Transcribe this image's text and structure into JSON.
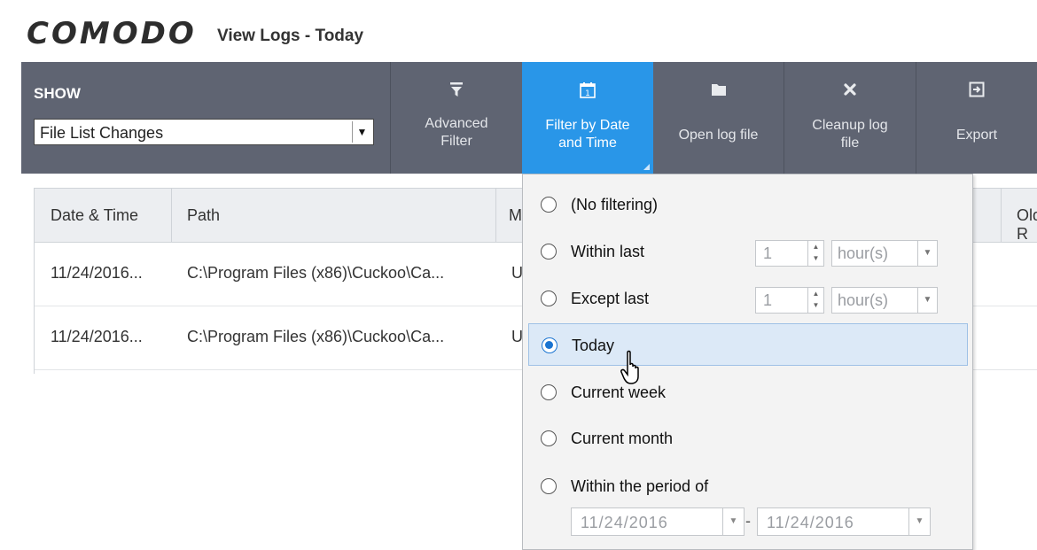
{
  "window": {
    "brand": "COMODO",
    "title": "View Logs - Today"
  },
  "toolbar": {
    "show_label": "SHOW",
    "show_value": "File List Changes",
    "buttons": [
      {
        "label_1": "Advanced",
        "label_2": "Filter",
        "icon": "funnel-icon"
      },
      {
        "label_1": "Filter by Date",
        "label_2": "and Time",
        "icon": "calendar-icon"
      },
      {
        "label_1": "Open log file",
        "label_2": "",
        "icon": "folder-icon"
      },
      {
        "label_1": "Cleanup log",
        "label_2": "file",
        "icon": "close-x-icon"
      },
      {
        "label_1": "Export",
        "label_2": "",
        "icon": "export-icon"
      }
    ],
    "calendar_day": "1"
  },
  "table": {
    "columns": [
      "Date & Time",
      "Path",
      "M",
      "Old R"
    ],
    "rows": [
      {
        "date": "11/24/2016...",
        "path": "C:\\Program Files (x86)\\Cuckoo\\Ca...",
        "m": "U"
      },
      {
        "date": "11/24/2016...",
        "path": "C:\\Program Files (x86)\\Cuckoo\\Ca...",
        "m": "U"
      }
    ]
  },
  "filter_menu": {
    "options": [
      "(No filtering)",
      "Within last",
      "Except last",
      "Today",
      "Current week",
      "Current month",
      "Within the period of"
    ],
    "selected": "Today",
    "within_last": {
      "value": "1",
      "unit": "hour(s)"
    },
    "except_last": {
      "value": "1",
      "unit": "hour(s)"
    },
    "period": {
      "from": "11/24/2016",
      "separator": "-",
      "to": "11/24/2016"
    }
  }
}
